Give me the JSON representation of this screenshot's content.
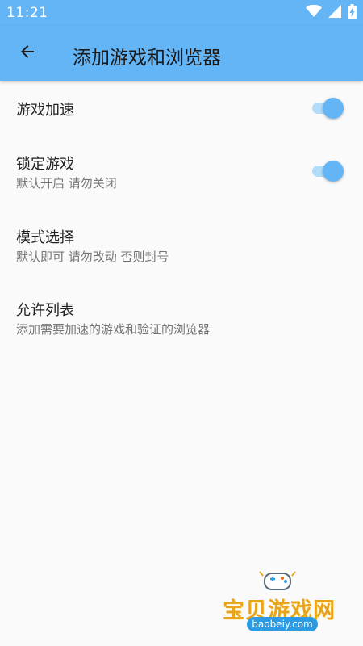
{
  "status_bar": {
    "time": "11:21",
    "icons": [
      "wifi-icon",
      "cellular-signal-icon",
      "battery-charging-icon"
    ]
  },
  "app_bar": {
    "back_icon": "arrow-left-icon",
    "title": "添加游戏和浏览器"
  },
  "settings": {
    "items": [
      {
        "title": "游戏加速",
        "summary": "",
        "switch_on": true
      },
      {
        "title": "锁定游戏",
        "summary": "默认开启 请勿关闭",
        "switch_on": true
      },
      {
        "title": "模式选择",
        "summary": "默认即可 请勿改动 否则封号"
      },
      {
        "title": "允许列表",
        "summary": "添加需要加速的游戏和验证的浏览器"
      }
    ]
  },
  "watermark": {
    "name": "宝贝游戏网",
    "url": "baobeiy.com",
    "icon": "gamepad-icon"
  },
  "colors": {
    "primary": "#64b5f6",
    "switch_track": "#b3dcf9",
    "background": "#fafafa",
    "title_text": "#212121",
    "summary_text": "#757575"
  }
}
